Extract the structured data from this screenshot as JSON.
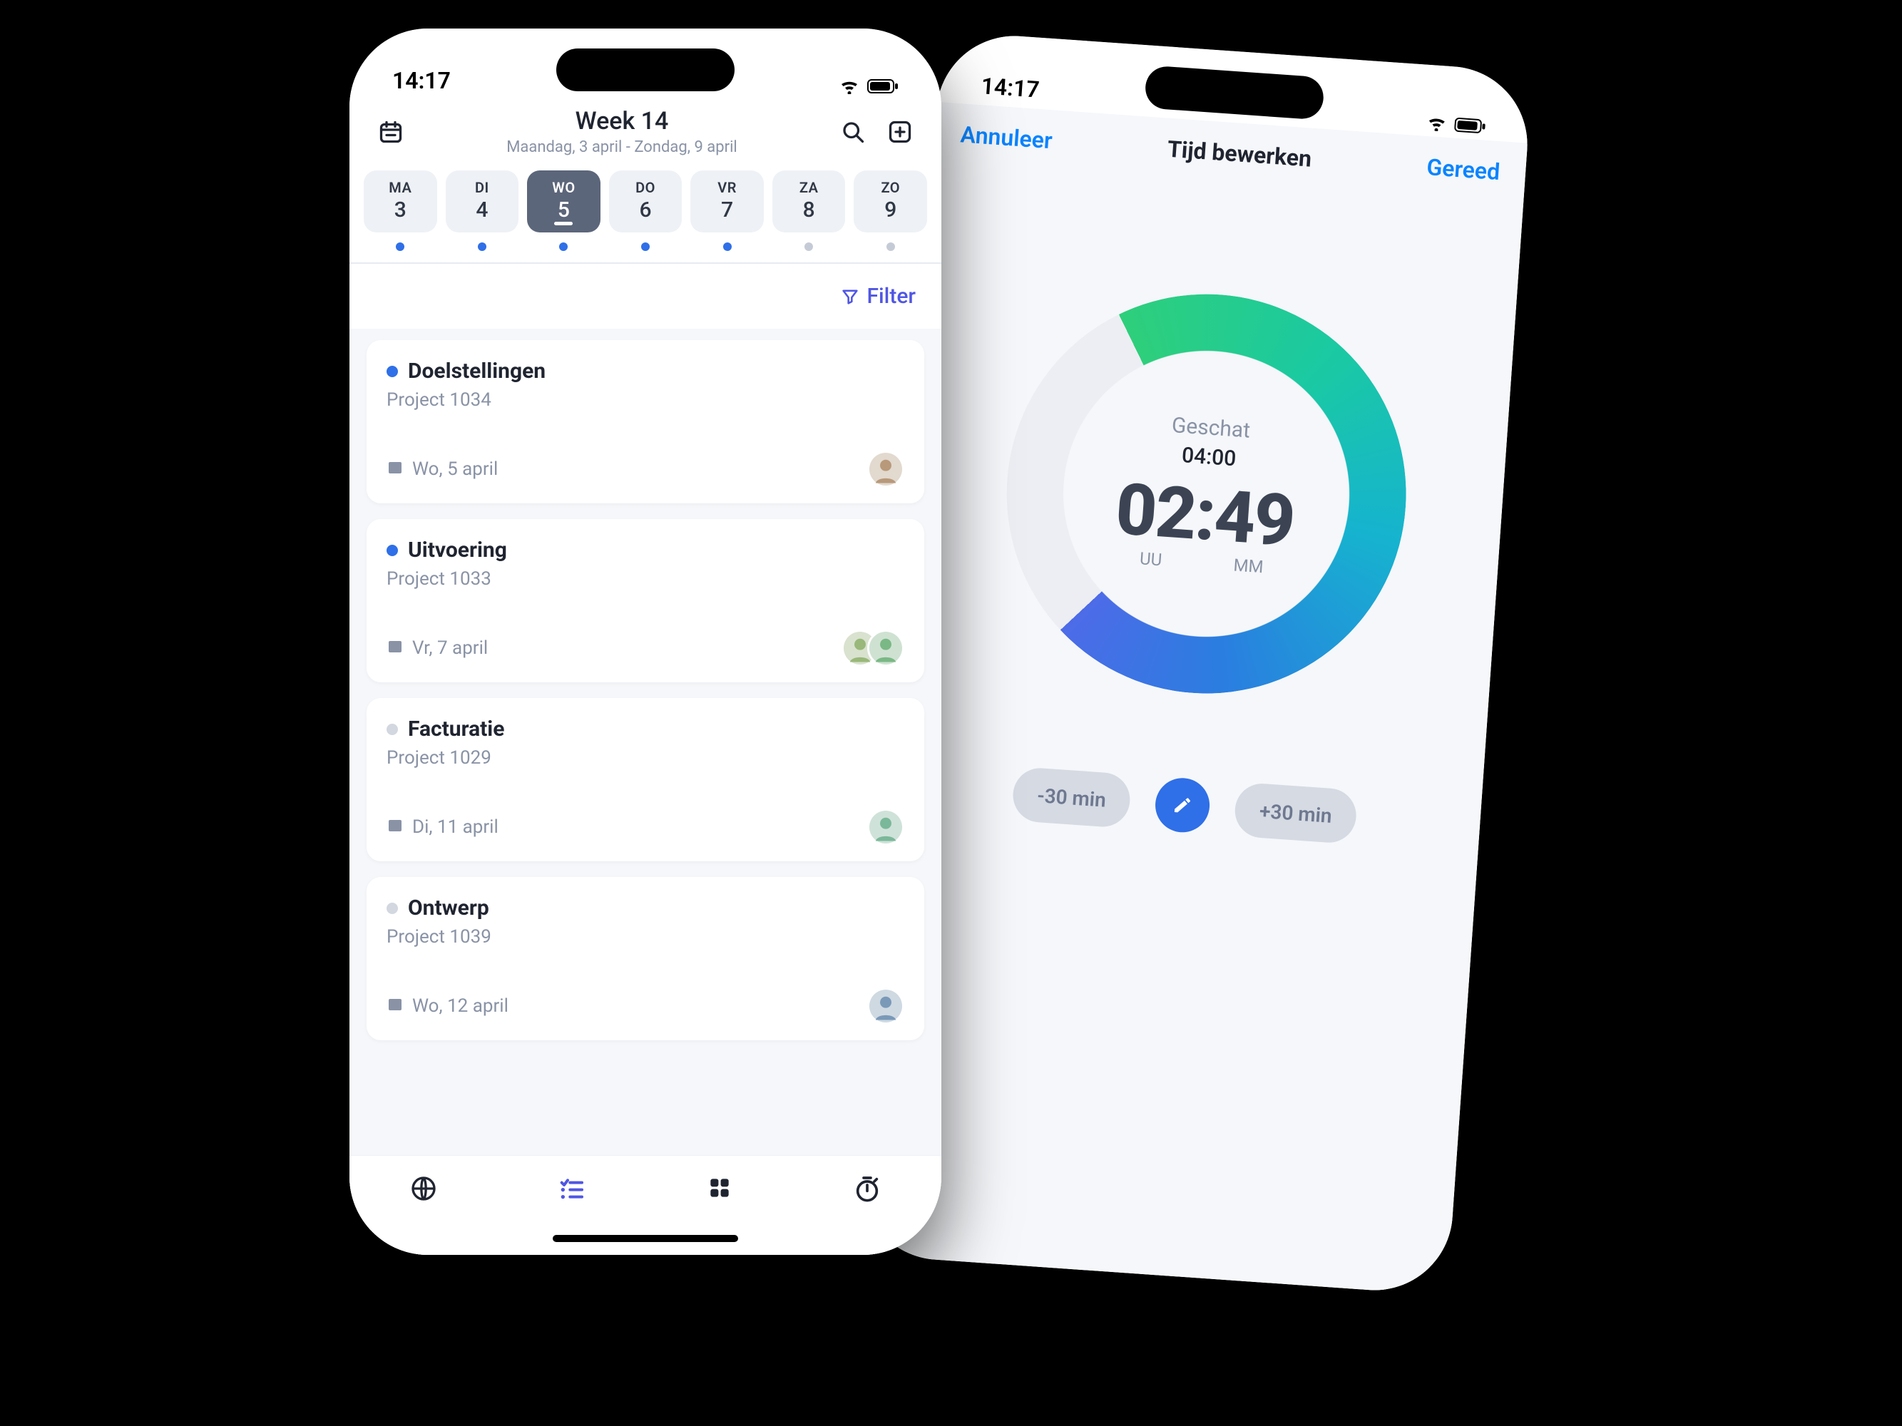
{
  "status": {
    "time": "14:17"
  },
  "header": {
    "title": "Week 14",
    "subtitle": "Maandag, 3 april - Zondag, 9 april"
  },
  "days": [
    {
      "abbr": "MA",
      "num": "3",
      "active": false,
      "dot": "blue"
    },
    {
      "abbr": "DI",
      "num": "4",
      "active": false,
      "dot": "blue"
    },
    {
      "abbr": "WO",
      "num": "5",
      "active": true,
      "dot": "blue"
    },
    {
      "abbr": "DO",
      "num": "6",
      "active": false,
      "dot": "blue"
    },
    {
      "abbr": "VR",
      "num": "7",
      "active": false,
      "dot": "blue"
    },
    {
      "abbr": "ZA",
      "num": "8",
      "active": false,
      "dot": "grey"
    },
    {
      "abbr": "ZO",
      "num": "9",
      "active": false,
      "dot": "grey"
    }
  ],
  "filter_label": "Filter",
  "cards": [
    {
      "status": "blue",
      "title": "Doelstellingen",
      "subtitle": "Project 1034",
      "date": "Wo, 5 april",
      "avatars": 1
    },
    {
      "status": "blue",
      "title": "Uitvoering",
      "subtitle": "Project 1033",
      "date": "Vr, 7 april",
      "avatars": 2
    },
    {
      "status": "grey",
      "title": "Facturatie",
      "subtitle": "Project 1029",
      "date": "Di, 11 april",
      "avatars": 1
    },
    {
      "status": "grey",
      "title": "Ontwerp",
      "subtitle": "Project 1039",
      "date": "Wo, 12 april",
      "avatars": 1
    }
  ],
  "editor": {
    "cancel": "Annuleer",
    "title": "Tijd bewerken",
    "done": "Gereed",
    "estimate_label": "Geschat",
    "estimate_value": "04:00",
    "time": "02:49",
    "unit_h": "UU",
    "unit_m": "MM",
    "minus": "-30 min",
    "plus": "+30 min"
  }
}
